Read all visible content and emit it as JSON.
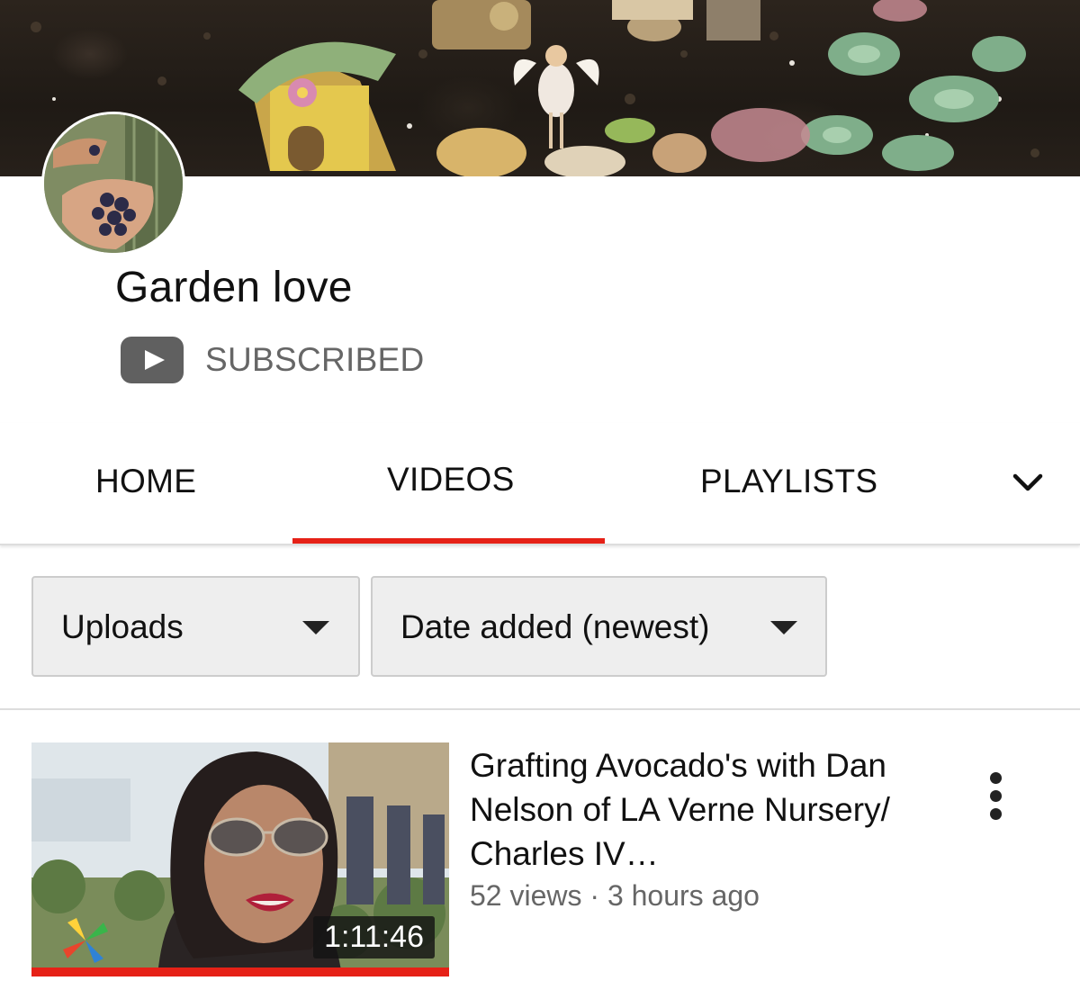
{
  "channel": {
    "name": "Garden love",
    "subscription_status": "SUBSCRIBED"
  },
  "tabs": [
    {
      "label": "HOME",
      "selected": false
    },
    {
      "label": "VIDEOS",
      "selected": true
    },
    {
      "label": "PLAYLISTS",
      "selected": false
    }
  ],
  "filters": {
    "source": "Uploads",
    "sort": "Date added (newest)"
  },
  "videos": [
    {
      "title": "Grafting Avocado's with Dan Nelson of LA Verne Nursery/ Charles IV…",
      "views": "52 views",
      "separator": "·",
      "uploaded": "3 hours ago",
      "meta": "52 views · 3 hours ago",
      "duration": "1:11:46",
      "watched_fraction": 1.0
    }
  ],
  "colors": {
    "accent": "#e62117",
    "secondary_text": "#666666",
    "filter_background": "#eeeeee"
  },
  "icons": {
    "subscribe": "youtube-play-icon",
    "more_tabs": "chevron-down-icon",
    "filter_caret": "caret-down-icon",
    "video_actions": "more-vert-icon"
  }
}
